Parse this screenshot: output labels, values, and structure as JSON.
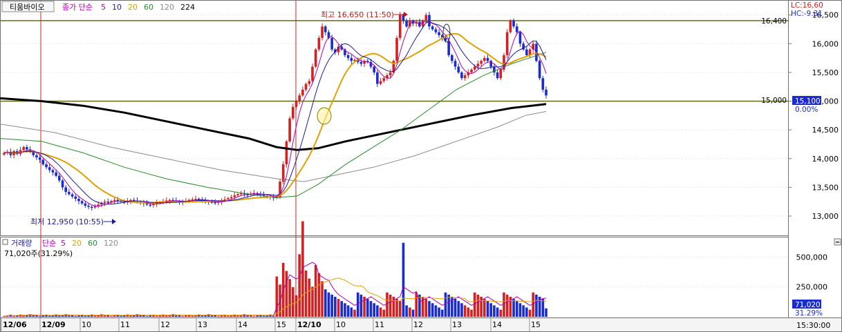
{
  "price_panel": {
    "stock_name": "티움바이오",
    "legend_prefix": "종가 단순",
    "ma_periods": [
      "5",
      "10",
      "20",
      "60",
      "120",
      "224"
    ],
    "ma_colors": [
      "#b000b0",
      "#1a1aa0",
      "#e0a000",
      "#2a8a2a",
      "#8a8a8a",
      "#000000"
    ],
    "lc_label": "LC:16,60",
    "hc_label": "HC:-9.31",
    "current_price_badge": "15,100",
    "change_pct": "0.00%",
    "high_annotation": "최고 16,650 (11:50)",
    "low_annotation": "최저 12,950 (10:55)",
    "reference_line_labels": [
      "16,400",
      "15,000"
    ]
  },
  "volume_panel": {
    "title": "거래량",
    "legend_prefix": "단순",
    "ma_periods": [
      "5",
      "20",
      "60",
      "120"
    ],
    "ma_colors": [
      "#b000b0",
      "#e0a000",
      "#2a8a2a",
      "#8a8a8a"
    ],
    "summary": "71,020주(31.29%)",
    "current_badge": "71,020",
    "current_pct": "31.29%"
  },
  "time_axis": {
    "labels": [
      "12/06",
      "12/09",
      "10",
      "11",
      "12",
      "13",
      "14",
      "15",
      "12/10",
      "10",
      "11",
      "12",
      "13",
      "14",
      "15"
    ],
    "current_time": "15:30:00"
  },
  "colors": {
    "up": "#d42020",
    "down": "#1a2bd0",
    "hline": "#5a5a00",
    "session": "#d02020"
  },
  "chart_data": [
    {
      "type": "candlestick",
      "title": "티움바이오",
      "y_ticks": [
        "16,500",
        "16,000",
        "15,500",
        "15,000",
        "14,500",
        "14,000",
        "13,500",
        "13,000"
      ],
      "y_tick_values": [
        16500,
        16000,
        15500,
        15000,
        14500,
        14000,
        13500,
        13000
      ],
      "ylim": [
        12700,
        16700
      ],
      "reference_lines": [
        16400,
        15000
      ],
      "high": {
        "value": 16650,
        "time": "11:50"
      },
      "low": {
        "value": 12950,
        "time": "10:55"
      },
      "last": 15100,
      "close_series": [
        14100,
        14120,
        14060,
        14130,
        14080,
        14150,
        14200,
        14160,
        14120,
        14060,
        14020,
        13980,
        13900,
        13850,
        13800,
        13760,
        13700,
        13620,
        13500,
        13420,
        13380,
        13340,
        13300,
        13260,
        13220,
        13180,
        13160,
        13150,
        13170,
        13200,
        13230,
        13250,
        13240,
        13260,
        13280,
        13270,
        13250,
        13240,
        13260,
        13280,
        13270,
        13250,
        13240,
        13220,
        13200,
        13190,
        13210,
        13230,
        13240,
        13260,
        13270,
        13280,
        13270,
        13260,
        13240,
        13250,
        13260,
        13280,
        13290,
        13300,
        13290,
        13270,
        13260,
        13250,
        13240,
        13230,
        13250,
        13270,
        13290,
        13310,
        13330,
        13360,
        13380,
        13400,
        13380,
        13370,
        13390,
        13400,
        13390,
        13370,
        13350,
        13340,
        13330,
        13320,
        13330,
        13600,
        13900,
        14300,
        14700,
        14900,
        15000,
        15100,
        15200,
        15300,
        15350,
        15600,
        15900,
        16100,
        16300,
        16200,
        16100,
        15900,
        15850,
        15950,
        15900,
        15800,
        15750,
        15700,
        15720,
        15680,
        15650,
        15700,
        15680,
        15600,
        15500,
        15300,
        15350,
        15400,
        15450,
        15500,
        15700,
        16100,
        16500,
        16400,
        16300,
        16400,
        16350,
        16380,
        16300,
        16400,
        16500,
        16300,
        16250,
        16200,
        16150,
        16100,
        16050,
        15800,
        15700,
        15600,
        15500,
        15400,
        15450,
        15500,
        15550,
        15600,
        15650,
        15700,
        15750,
        15700,
        15600,
        15500,
        15400,
        15550,
        15800,
        16200,
        16400,
        16300,
        16200,
        16000,
        15900,
        15800,
        15900,
        16000,
        15700,
        15400,
        15200,
        15100
      ],
      "ma_series": [
        {
          "name": "120",
          "points": [
            [
              0,
              14600
            ],
            [
              80,
              14450
            ],
            [
              160,
              14200
            ],
            [
              240,
              14000
            ],
            [
              320,
              13800
            ],
            [
              400,
              13650
            ],
            [
              440,
              13600
            ],
            [
              480,
              13700
            ],
            [
              540,
              13850
            ],
            [
              600,
              14050
            ],
            [
              660,
              14300
            ],
            [
              720,
              14550
            ],
            [
              760,
              14750
            ],
            [
              790,
              14820
            ]
          ]
        },
        {
          "name": "224",
          "points": [
            [
              0,
              15050
            ],
            [
              60,
              15000
            ],
            [
              120,
              14920
            ],
            [
              180,
              14800
            ],
            [
              240,
              14650
            ],
            [
              300,
              14500
            ],
            [
              360,
              14350
            ],
            [
              400,
              14200
            ],
            [
              430,
              14150
            ],
            [
              460,
              14180
            ],
            [
              500,
              14300
            ],
            [
              560,
              14450
            ],
            [
              620,
              14600
            ],
            [
              680,
              14750
            ],
            [
              740,
              14880
            ],
            [
              790,
              14950
            ]
          ]
        },
        {
          "name": "60",
          "points": [
            [
              0,
              14350
            ],
            [
              60,
              14300
            ],
            [
              120,
              14100
            ],
            [
              180,
              13850
            ],
            [
              240,
              13650
            ],
            [
              300,
              13500
            ],
            [
              350,
              13400
            ],
            [
              400,
              13320
            ],
            [
              430,
              13350
            ],
            [
              460,
              13550
            ],
            [
              500,
              13900
            ],
            [
              540,
              14200
            ],
            [
              580,
              14500
            ],
            [
              620,
              14850
            ],
            [
              660,
              15200
            ],
            [
              700,
              15450
            ],
            [
              740,
              15650
            ],
            [
              790,
              15850
            ]
          ]
        }
      ]
    },
    {
      "type": "bar",
      "title": "거래량",
      "y_ticks": [
        "500,000",
        "250,000"
      ],
      "y_tick_values": [
        500000,
        250000
      ],
      "ylim": [
        0,
        630000
      ],
      "current": 71020,
      "peak_bars": [
        {
          "session": "12/10",
          "time": "09:05",
          "value": 530000
        },
        {
          "session": "12/10",
          "time": "11:50",
          "value": 620000
        }
      ]
    }
  ]
}
